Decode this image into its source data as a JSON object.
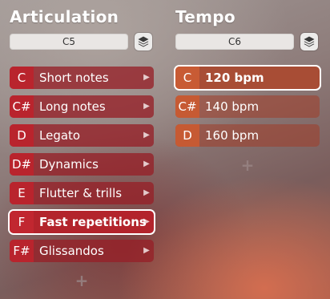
{
  "articulation": {
    "title": "Articulation",
    "note": "C5",
    "selected_index": 5,
    "items": [
      {
        "key": "C",
        "label": "Short notes"
      },
      {
        "key": "C#",
        "label": "Long notes"
      },
      {
        "key": "D",
        "label": "Legato"
      },
      {
        "key": "D#",
        "label": "Dynamics"
      },
      {
        "key": "E",
        "label": "Flutter & trills"
      },
      {
        "key": "F",
        "label": "Fast repetitions"
      },
      {
        "key": "F#",
        "label": "Glissandos"
      }
    ],
    "add_label": "+"
  },
  "tempo": {
    "title": "Tempo",
    "note": "C6",
    "selected_index": 0,
    "items": [
      {
        "key": "C",
        "label": "120 bpm"
      },
      {
        "key": "C#",
        "label": "140 bpm"
      },
      {
        "key": "D",
        "label": "160 bpm"
      }
    ],
    "add_label": "+"
  },
  "icons": {
    "item_chevron": "chevron-right-icon",
    "stack_button": "layers-icon"
  },
  "colors": {
    "articulation_key": "#b9242d",
    "tempo_key": "#c65a33",
    "selection_outline": "#ffffff"
  }
}
